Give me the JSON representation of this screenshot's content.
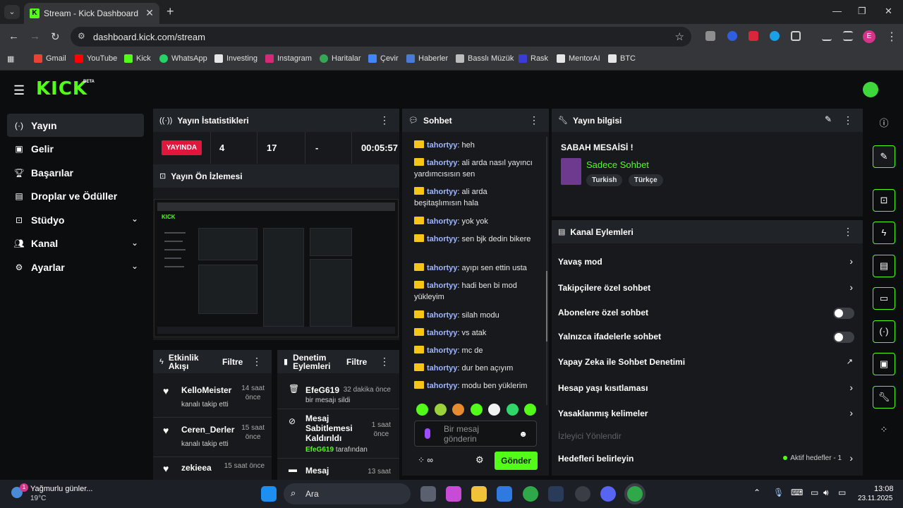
{
  "browser": {
    "tab_title": "Stream - Kick Dashboard",
    "tab_favicon": "K",
    "url": "dashboard.kick.com/stream",
    "profile_initial": "E",
    "bookmarks": [
      "Gmail",
      "YouTube",
      "Kick",
      "WhatsApp",
      "Investing",
      "Instagram",
      "Haritalar",
      "Çevir",
      "Haberler",
      "Basslı Müzük",
      "Rask",
      "MentorAI",
      "BTC"
    ]
  },
  "app": {
    "logo": "KICK",
    "logo_badge": "BETA",
    "accent_color": "#53fc18"
  },
  "sidebar": {
    "items": [
      {
        "label": "Yayın",
        "icon": "broadcast-icon"
      },
      {
        "label": "Gelir",
        "icon": "revenue-icon"
      },
      {
        "label": "Başarılar",
        "icon": "trophy-icon"
      },
      {
        "label": "Droplar ve Ödüller",
        "icon": "gift-icon"
      },
      {
        "label": "Stüdyo",
        "icon": "studio-icon"
      },
      {
        "label": "Kanal",
        "icon": "users-icon"
      },
      {
        "label": "Ayarlar",
        "icon": "settings-icon"
      }
    ]
  },
  "stats": {
    "title": "Yayın İstatistikleri",
    "live_badge": "YAYINDA",
    "viewers": "4",
    "followers": "17",
    "other": "-",
    "duration": "00:05:57"
  },
  "preview": {
    "title": "Yayın Ön İzlemesi"
  },
  "activity": {
    "title_line1": "Etkinlik",
    "title_line2": "Akışı",
    "filter": "Filtre",
    "items": [
      {
        "name": "KelloMeister",
        "time_line1": "14 saat",
        "time_line2": "önce",
        "sub": "kanalı takip etti"
      },
      {
        "name": "Ceren_Derler",
        "time_line1": "15 saat",
        "time_line2": "önce",
        "sub": "kanalı takip etti"
      },
      {
        "name": "zekieea",
        "time_line1": "15 saat önce",
        "time_line2": "",
        "sub": ""
      }
    ]
  },
  "moderation": {
    "title_line1": "Denetim",
    "title_line2": "Eylemleri",
    "filter": "Filtre",
    "items": [
      {
        "name": "EfeG619",
        "time": "32 dakika önce",
        "sub": "bir mesajı sildi"
      },
      {
        "name_line1": "Mesaj",
        "name_line2": "Sabitlemesi",
        "name_line3": "Kaldırıldı",
        "time_line1": "1 saat",
        "time_line2": "önce",
        "by_user": "EfeG619",
        "by_text": "tarafından"
      },
      {
        "name": "Mesaj",
        "time": "13 saat"
      }
    ]
  },
  "chat": {
    "title": "Sohbet",
    "user": "tahortyy",
    "messages": [
      "heh",
      "ali arda nasıl yayıncı yardımcısısın sen",
      "ali arda beşitaşlımısın hala",
      "yok yok",
      "sen bjk dedin bikere",
      "ayıpı sen ettin usta",
      "hadi ben bi mod yükleyim",
      "silah modu",
      "vs atak",
      "mc de",
      "dur ben açıyım",
      "modu ben yüklerim"
    ],
    "input_placeholder": "Bir mesaj gönderin",
    "send_label": "Gönder"
  },
  "stream_info": {
    "title": "Yayın bilgisi",
    "stream_title": "SABAH MESAİSİ !",
    "category": "Sadece Sohbet",
    "tags": [
      "Turkish",
      "Türkçe"
    ]
  },
  "channel_actions": {
    "title": "Kanal Eylemleri",
    "rows": [
      {
        "label": "Yavaş mod",
        "control": "arrow"
      },
      {
        "label": "Takipçilere özel sohbet",
        "control": "arrow"
      },
      {
        "label": "Abonelere özel sohbet",
        "control": "toggle"
      },
      {
        "label": "Yalnızca ifadelerle sohbet",
        "control": "toggle"
      },
      {
        "label": "Yapay Zeka ile Sohbet Denetimi",
        "control": "external"
      },
      {
        "label": "Hesap yaşı kısıtlaması",
        "control": "arrow"
      },
      {
        "label": "Yasaklanmış kelimeler",
        "control": "arrow"
      },
      {
        "label": "İzleyici Yönlendir",
        "control": "none"
      },
      {
        "label": "Hedefleri belirleyin",
        "control": "arrow"
      }
    ],
    "goals_status": "Aktif hedefler - 1"
  },
  "taskbar": {
    "weather_text": "Yağmurlu günler...",
    "weather_temp": "19°C",
    "weather_badge": "1",
    "search": "Ara",
    "time": "13:08",
    "date": "23.11.2025"
  }
}
